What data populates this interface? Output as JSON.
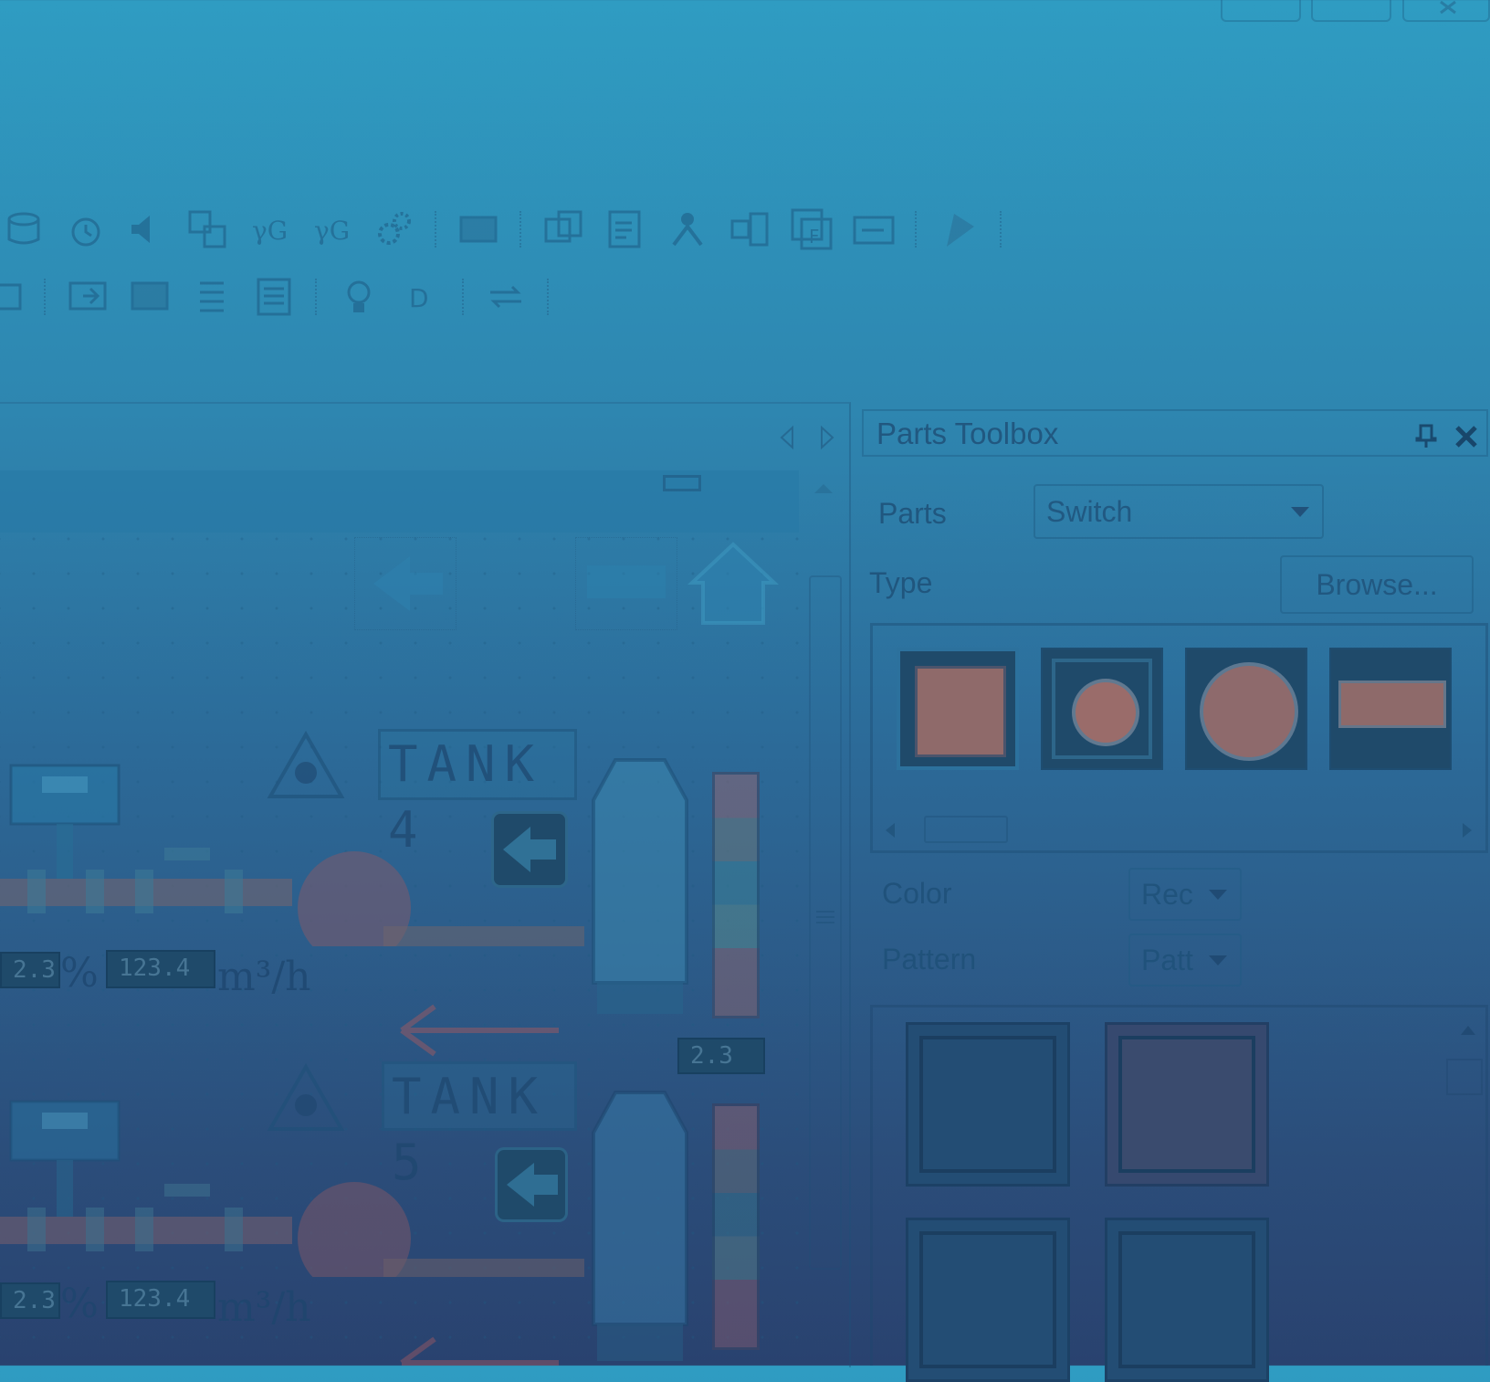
{
  "window_controls": [
    "minimize",
    "restore",
    "close"
  ],
  "toolbar": {
    "row1_icons": [
      "database-icon",
      "clock-settings-icon",
      "speaker-icon",
      "translate-icon",
      "script-icon",
      "script-edit-icon",
      "gears-icon",
      "screen-icon",
      "window-copy-icon",
      "checklist-edit-icon",
      "person-icon",
      "network-icon",
      "form-icon",
      "panel-icon",
      "flag-icon"
    ],
    "row2_icons": [
      "display-icon",
      "monitor-arrow-icon",
      "monitor-icon",
      "list-icon",
      "list-alt-icon",
      "bulb-icon",
      "letter-d-icon",
      "transfer-icon"
    ]
  },
  "editor": {
    "tanks": [
      {
        "label": "TANK 4",
        "lcd_percent": "2.3",
        "lcd_flow": "123.4",
        "lcd_level": "2.3",
        "percent_unit": "%",
        "flow_unit": "m³/h"
      },
      {
        "label": "TANK 5",
        "lcd_percent": "2.3",
        "lcd_flow": "123.4",
        "percent_unit": "%",
        "flow_unit": "m³/h"
      }
    ]
  },
  "parts_toolbox": {
    "title": "Parts Toolbox",
    "parts_label": "Parts",
    "parts_value": "Switch",
    "type_label": "Type",
    "browse_label": "Browse...",
    "color_label": "Color",
    "color_value": "Rec",
    "pattern_label": "Pattern",
    "pattern_value": "Patt"
  },
  "colors": {
    "accent": "#2f9cc2",
    "dark": "#29426f",
    "switch_face": "#9a6f6a",
    "lcd_bg": "#1f4a6a"
  }
}
